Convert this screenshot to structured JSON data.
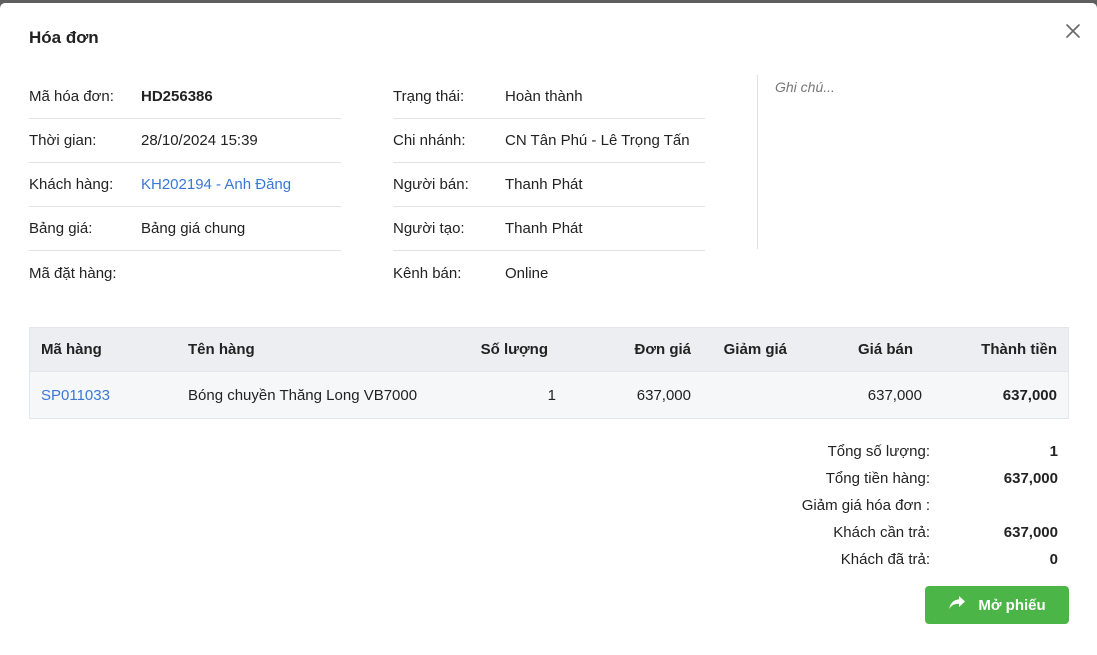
{
  "modal": {
    "title": "Hóa đơn",
    "close_icon": "close-icon"
  },
  "info_left": [
    {
      "label": "Mã hóa đơn:",
      "value": "HD256386",
      "style": "bold"
    },
    {
      "label": "Thời gian:",
      "value": "28/10/2024 15:39",
      "style": "normal"
    },
    {
      "label": "Khách hàng:",
      "value": "KH202194 - Anh Đăng",
      "style": "link"
    },
    {
      "label": "Bảng giá:",
      "value": "Bảng giá chung",
      "style": "normal"
    },
    {
      "label": "Mã đặt hàng:",
      "value": "",
      "style": "normal"
    }
  ],
  "info_mid": [
    {
      "label": "Trạng thái:",
      "value": "Hoàn thành"
    },
    {
      "label": "Chi nhánh:",
      "value": "CN Tân Phú - Lê Trọng Tấn"
    },
    {
      "label": "Người bán:",
      "value": "Thanh Phát"
    },
    {
      "label": "Người tạo:",
      "value": "Thanh Phát"
    },
    {
      "label": "Kênh bán:",
      "value": "Online"
    }
  ],
  "note": {
    "placeholder": "Ghi chú..."
  },
  "table": {
    "headers": {
      "code": "Mã hàng",
      "name": "Tên hàng",
      "qty": "Số lượng",
      "unit_price": "Đơn giá",
      "discount": "Giảm giá",
      "sale_price": "Giá bán",
      "total": "Thành tiền"
    },
    "rows": [
      {
        "code": "SP011033",
        "name": "Bóng chuyền Thăng Long VB7000",
        "qty": "1",
        "unit_price": "637,000",
        "discount": "",
        "sale_price": "637,000",
        "total": "637,000"
      }
    ]
  },
  "summary": [
    {
      "label": "Tổng số lượng:",
      "value": "1"
    },
    {
      "label": "Tổng tiền hàng:",
      "value": "637,000"
    },
    {
      "label": "Giảm giá hóa đơn :",
      "value": ""
    },
    {
      "label": "Khách cần trả:",
      "value": "637,000"
    },
    {
      "label": "Khách đã trả:",
      "value": "0"
    }
  ],
  "actions": {
    "open_label": "Mở phiếu",
    "open_icon": "share-arrow-icon",
    "button_color": "#4cb548"
  },
  "colors": {
    "link": "#3a78d4",
    "table_header_bg": "#eceef1"
  }
}
